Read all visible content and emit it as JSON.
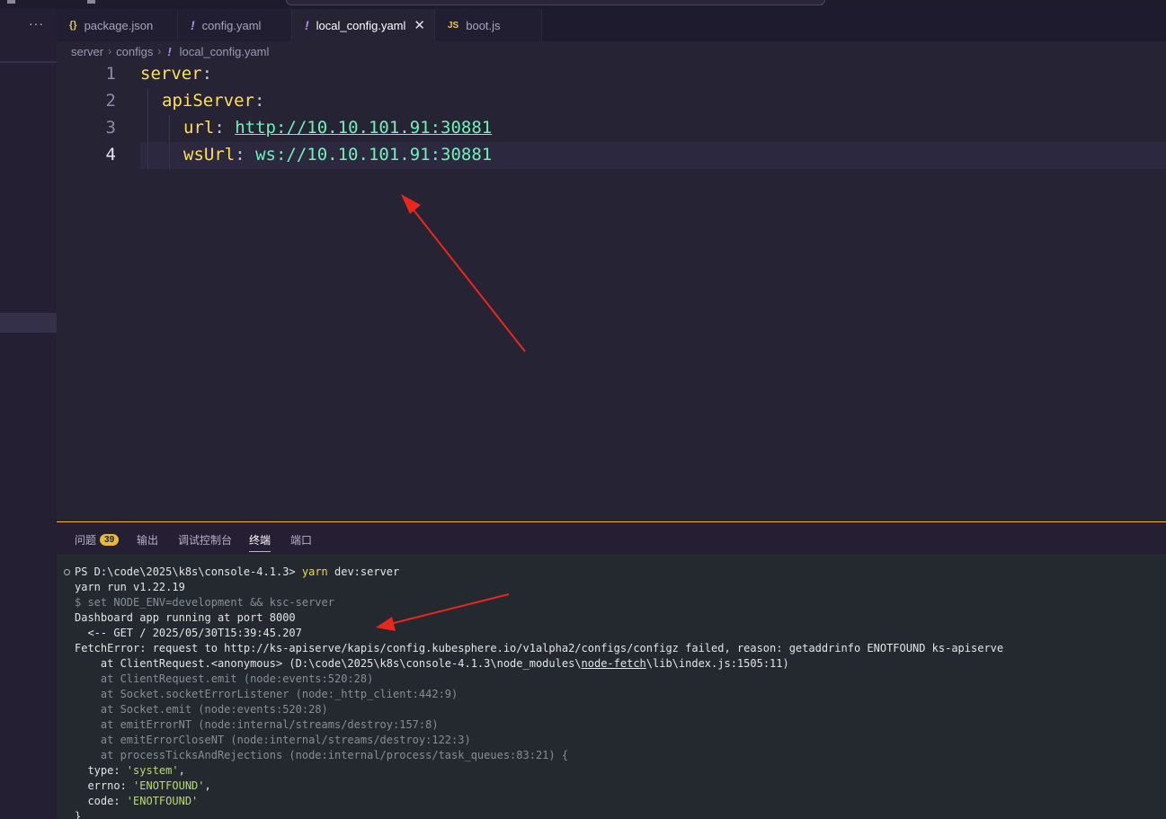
{
  "tabs": [
    {
      "icon": "{}",
      "label": "package.json"
    },
    {
      "icon": "!",
      "label": "config.yaml"
    },
    {
      "icon": "!",
      "label": "local_config.yaml",
      "close": "✕"
    },
    {
      "icon": "JS",
      "label": "boot.js"
    }
  ],
  "sidebar": {
    "more": "···"
  },
  "breadcrumb": {
    "items": [
      "server",
      "configs",
      "local_config.yaml"
    ],
    "file_icon": "!"
  },
  "editor": {
    "line_numbers": [
      "1",
      "2",
      "3",
      "4"
    ],
    "lines": [
      {
        "key": "server",
        "colon": ":"
      },
      {
        "key": "apiServer",
        "colon": ":"
      },
      {
        "key": "url",
        "colon": ":",
        "value": "http://10.10.101.91:30881"
      },
      {
        "key": "wsUrl",
        "colon": ":",
        "value": "ws://10.10.101.91:30881"
      }
    ]
  },
  "panel": {
    "tabs": [
      "问题",
      "输出",
      "调试控制台",
      "终端",
      "端口"
    ],
    "problems_count": "39"
  },
  "terminal": {
    "prompt": "PS D:\\code\\2025\\k8s\\console-4.1.3> ",
    "command_tool": "yarn",
    "command_args": " dev:server",
    "lines": [
      "yarn run v1.22.19",
      "$ set NODE_ENV=development && ksc-server",
      "Dashboard app running at port 8000",
      "  <-- GET / 2025/05/30T15:39:45.207",
      "FetchError: request to http://ks-apiserve/kapis/config.kubesphere.io/v1alpha2/configs/configz failed, reason: getaddrinfo ENOTFOUND ks-apiserve",
      "    at ClientRequest.<anonymous> (D:\\code\\2025\\k8s\\console-4.1.3\\node_modules\\node-fetch\\lib\\index.js:1505:11)",
      "    at ClientRequest.emit (node:events:520:28)",
      "    at Socket.socketErrorListener (node:_http_client:442:9)",
      "    at Socket.emit (node:events:520:28)",
      "    at emitErrorNT (node:internal/streams/destroy:157:8)",
      "    at emitErrorCloseNT (node:internal/streams/destroy:122:3)",
      "    at processTicksAndRejections (node:internal/process/task_queues:83:21) {",
      "  type: ",
      "  errno: ",
      "  code: ",
      "}"
    ],
    "trace_prefix": "    at ClientRequest.<anonymous> (D:\\code\\2025\\k8s\\console-4.1.3\\node_modules\\",
    "trace_link": "node-fetch",
    "trace_suffix": "\\lib\\index.js:1505:11)",
    "err_type": "'system'",
    "err_errno": "'ENOTFOUND'",
    "err_code": "'ENOTFOUND'",
    "comma": ","
  },
  "colors": {
    "accent": "#e6b83e",
    "key": "#fede5d",
    "string": "#72f1b8",
    "arrow": "#e8281e"
  }
}
